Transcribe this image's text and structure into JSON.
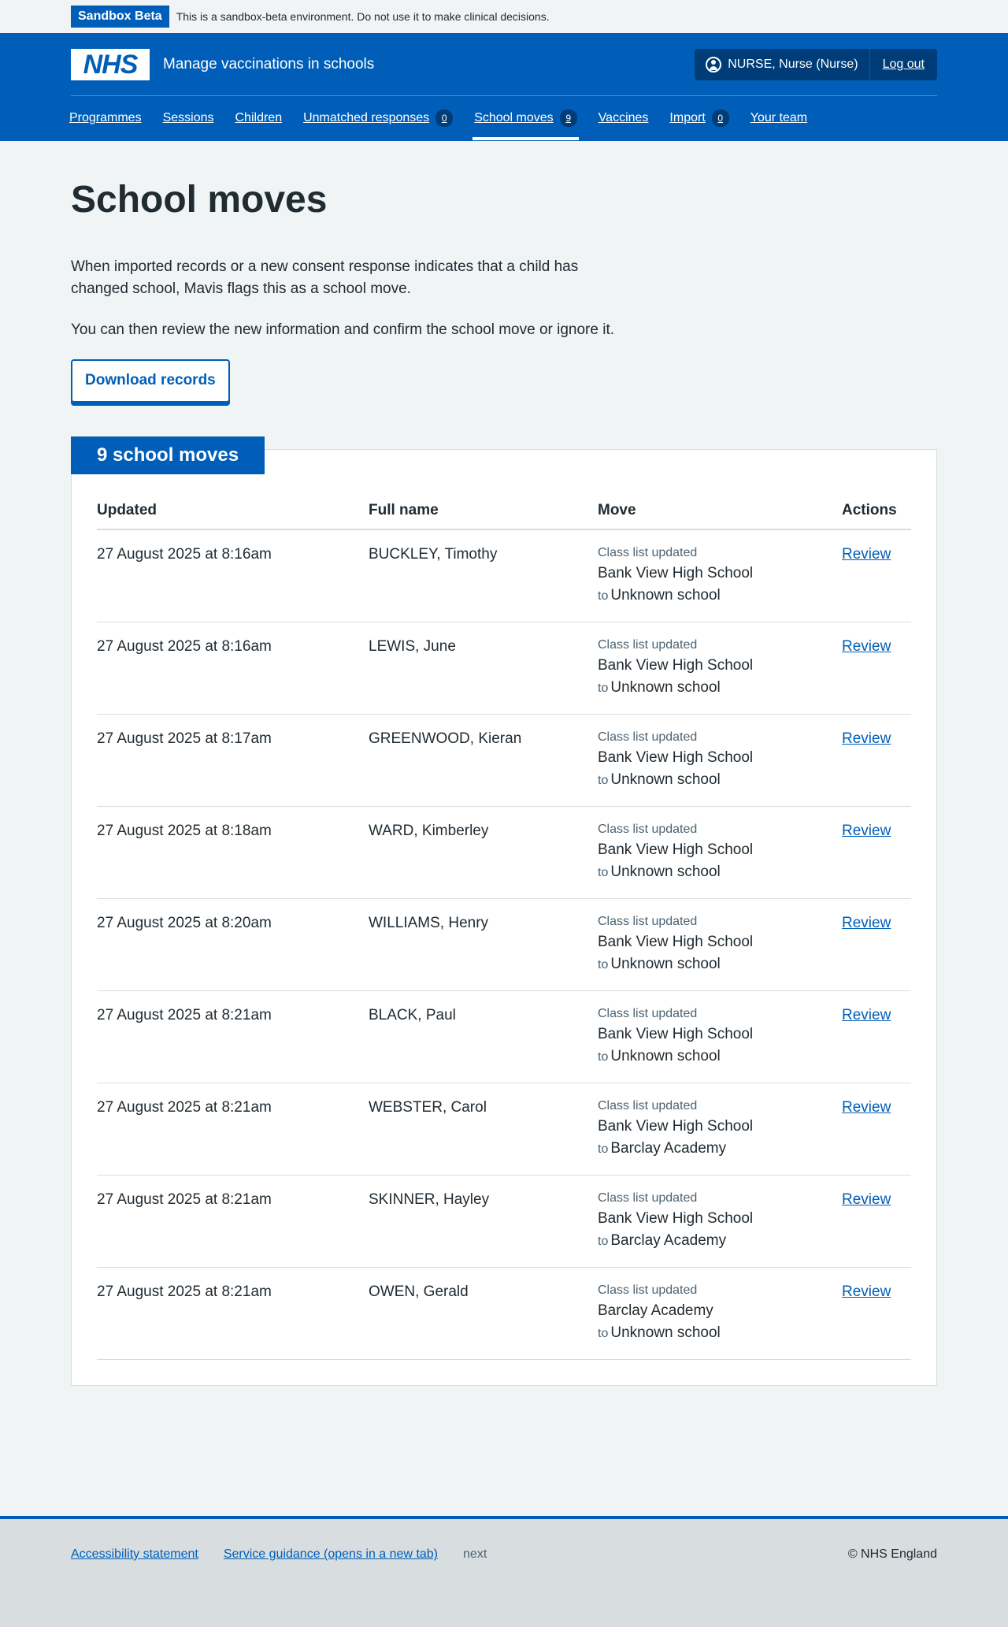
{
  "sandbox": {
    "tag": "Sandbox Beta",
    "message": "This is a sandbox-beta environment. Do not use it to make clinical decisions."
  },
  "header": {
    "logo_text": "NHS",
    "service_name": "Manage vaccinations in schools",
    "user": "NURSE, Nurse (Nurse)",
    "logout": "Log out"
  },
  "nav": [
    {
      "label": "Programmes"
    },
    {
      "label": "Sessions"
    },
    {
      "label": "Children"
    },
    {
      "label": "Unmatched responses",
      "count": "0"
    },
    {
      "label": "School moves",
      "count": "9",
      "active": true
    },
    {
      "label": "Vaccines"
    },
    {
      "label": "Import",
      "count": "0"
    },
    {
      "label": "Your team"
    }
  ],
  "main": {
    "title": "School moves",
    "intro_1": "When imported records or a new consent response indicates that a child has changed school, Mavis flags this as a school move.",
    "intro_2": "You can then review the new information and confirm the school move or ignore it.",
    "download_button": "Download records"
  },
  "table": {
    "heading": "9 school moves",
    "columns": [
      "Updated",
      "Full name",
      "Move",
      "Actions"
    ],
    "to_word": "to",
    "rows": [
      {
        "updated": "27 August 2025 at 8:16am",
        "name": "BUCKLEY, Timothy",
        "label": "Class list updated",
        "from": "Bank View High School",
        "to": "Unknown school",
        "action": "Review"
      },
      {
        "updated": "27 August 2025 at 8:16am",
        "name": "LEWIS, June",
        "label": "Class list updated",
        "from": "Bank View High School",
        "to": "Unknown school",
        "action": "Review"
      },
      {
        "updated": "27 August 2025 at 8:17am",
        "name": "GREENWOOD, Kieran",
        "label": "Class list updated",
        "from": "Bank View High School",
        "to": "Unknown school",
        "action": "Review"
      },
      {
        "updated": "27 August 2025 at 8:18am",
        "name": "WARD, Kimberley",
        "label": "Class list updated",
        "from": "Bank View High School",
        "to": "Unknown school",
        "action": "Review"
      },
      {
        "updated": "27 August 2025 at 8:20am",
        "name": "WILLIAMS, Henry",
        "label": "Class list updated",
        "from": "Bank View High School",
        "to": "Unknown school",
        "action": "Review"
      },
      {
        "updated": "27 August 2025 at 8:21am",
        "name": "BLACK, Paul",
        "label": "Class list updated",
        "from": "Bank View High School",
        "to": "Unknown school",
        "action": "Review"
      },
      {
        "updated": "27 August 2025 at 8:21am",
        "name": "WEBSTER, Carol",
        "label": "Class list updated",
        "from": "Bank View High School",
        "to": "Barclay Academy",
        "action": "Review"
      },
      {
        "updated": "27 August 2025 at 8:21am",
        "name": "SKINNER, Hayley",
        "label": "Class list updated",
        "from": "Bank View High School",
        "to": "Barclay Academy",
        "action": "Review"
      },
      {
        "updated": "27 August 2025 at 8:21am",
        "name": "OWEN, Gerald",
        "label": "Class list updated",
        "from": "Barclay Academy",
        "to": "Unknown school",
        "action": "Review"
      }
    ]
  },
  "footer": {
    "links": [
      "Accessibility statement",
      "Service guidance (opens in a new tab)"
    ],
    "text": "next",
    "copyright": "© NHS England"
  }
}
